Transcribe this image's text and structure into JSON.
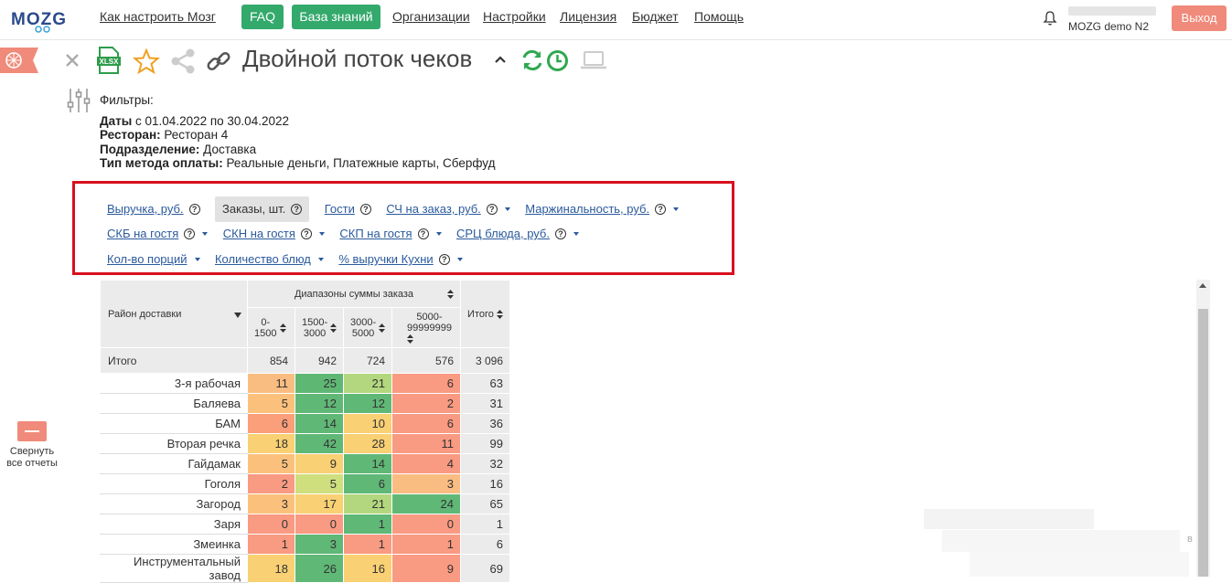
{
  "nav": {
    "logo": "MOZG",
    "how_to": "Как настроить Мозг",
    "faq": "FAQ",
    "kb": "База знаний",
    "orgs": "Организации",
    "settings": "Настройки",
    "license": "Лицензия",
    "budget": "Бюджет",
    "help": "Помощь",
    "user": "MOZG demo N2",
    "logout": "Выход"
  },
  "report": {
    "title": "Двойной поток чеков"
  },
  "filters": {
    "header": "Фильтры:",
    "dates_label": "Даты",
    "dates_value": " с 01.04.2022 по 30.04.2022",
    "restaurant_label": "Ресторан:",
    "restaurant_value": " Ресторан 4",
    "division_label": "Подразделение:",
    "division_value": " Доставка",
    "payment_label": "Тип метода оплаты:",
    "payment_value": " Реальные деньги, Платежные карты, Сберфуд"
  },
  "metrics": {
    "revenue": "Выручка, руб.",
    "orders": "Заказы, шт.",
    "guests": "Гости",
    "avg_check": "СЧ на заказ, руб.",
    "margin": "Маржинальность, руб.",
    "skb": "СКБ на гостя",
    "skn": "СКН на гостя",
    "skp": "СКП на гостя",
    "src": "СРЦ блюда, руб.",
    "portions": "Кол-во порций",
    "dishes": "Количество блюд",
    "kitchen": "% выручки Кухни",
    "help_glyph": "?"
  },
  "table": {
    "row_header": "Район доставки",
    "group_header": "Диапазоны суммы заказа",
    "total_header": "Итого",
    "columns": [
      "0-\n1500",
      "1500-\n3000",
      "3000-\n5000",
      "5000-\n99999999"
    ],
    "totals_label": "Итого",
    "totals": [
      "854",
      "942",
      "724",
      "576",
      "3 096"
    ],
    "rows": [
      {
        "name": "3-я рабочая",
        "values": [
          "11",
          "25",
          "21",
          "6"
        ],
        "total": "63"
      },
      {
        "name": "Баляева",
        "values": [
          "5",
          "12",
          "12",
          "2"
        ],
        "total": "31"
      },
      {
        "name": "БАМ",
        "values": [
          "6",
          "14",
          "10",
          "6"
        ],
        "total": "36"
      },
      {
        "name": "Вторая речка",
        "values": [
          "18",
          "42",
          "28",
          "11"
        ],
        "total": "99"
      },
      {
        "name": "Гайдамак",
        "values": [
          "5",
          "9",
          "14",
          "4"
        ],
        "total": "32"
      },
      {
        "name": "Гоголя",
        "values": [
          "2",
          "5",
          "6",
          "3"
        ],
        "total": "16"
      },
      {
        "name": "Загород",
        "values": [
          "3",
          "17",
          "21",
          "24"
        ],
        "total": "65"
      },
      {
        "name": "Заря",
        "values": [
          "0",
          "0",
          "1",
          "0"
        ],
        "total": "1"
      },
      {
        "name": "Змеинка",
        "values": [
          "1",
          "3",
          "1",
          "1"
        ],
        "total": "6"
      },
      {
        "name": "Инструментальный завод",
        "values": [
          "18",
          "26",
          "16",
          "9"
        ],
        "total": "69"
      }
    ],
    "colors": [
      [
        "#f9bd82",
        "#5fb774",
        "#b3d77e",
        "#f99a82"
      ],
      [
        "#fbc17c",
        "#60b877",
        "#60b877",
        "#f99a82"
      ],
      [
        "#fb9e7a",
        "#60b877",
        "#f9d073",
        "#f99a82"
      ],
      [
        "#f9d073",
        "#60b877",
        "#f9d073",
        "#f99a82"
      ],
      [
        "#fbc17c",
        "#f9d073",
        "#60b877",
        "#f99a82"
      ],
      [
        "#f99a82",
        "#cfdf7e",
        "#60b877",
        "#f9bd82"
      ],
      [
        "#fbc17c",
        "#f9d073",
        "#b3d77e",
        "#60b877"
      ],
      [
        "#f99a82",
        "#f99a82",
        "#60b877",
        "#f99a82"
      ],
      [
        "#f99a82",
        "#60b877",
        "#f99a82",
        "#f99a82"
      ],
      [
        "#f9d073",
        "#60b877",
        "#f9d073",
        "#f99a82"
      ]
    ]
  },
  "sidebar": {
    "collapse_label": "Свернуть\nвсе отчеты"
  },
  "stray": "в"
}
